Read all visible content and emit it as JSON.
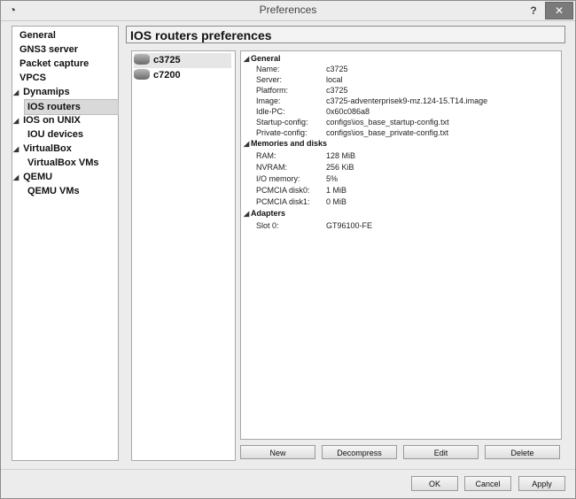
{
  "window": {
    "title": "Preferences",
    "help_label": "?",
    "close_label": "✕"
  },
  "nav": {
    "items": [
      {
        "label": "General",
        "indent": 0,
        "expand": ""
      },
      {
        "label": "GNS3 server",
        "indent": 0,
        "expand": ""
      },
      {
        "label": "Packet capture",
        "indent": 0,
        "expand": ""
      },
      {
        "label": "VPCS",
        "indent": 0,
        "expand": ""
      },
      {
        "label": "Dynamips",
        "indent": 0,
        "expand": "◢"
      },
      {
        "label": "IOS routers",
        "indent": 1,
        "expand": "",
        "selected": true
      },
      {
        "label": "IOS on UNIX",
        "indent": 0,
        "expand": "◢"
      },
      {
        "label": "IOU devices",
        "indent": 1,
        "expand": ""
      },
      {
        "label": "VirtualBox",
        "indent": 0,
        "expand": "◢"
      },
      {
        "label": "VirtualBox VMs",
        "indent": 1,
        "expand": ""
      },
      {
        "label": "QEMU",
        "indent": 0,
        "expand": "◢"
      },
      {
        "label": "QEMU VMs",
        "indent": 1,
        "expand": ""
      }
    ]
  },
  "page": {
    "title": "IOS routers preferences"
  },
  "routers": [
    {
      "name": "c3725",
      "selected": true
    },
    {
      "name": "c7200",
      "selected": false
    }
  ],
  "properties": {
    "general": {
      "label": "General",
      "rows": [
        {
          "name": "Name:",
          "value": "c3725"
        },
        {
          "name": "Server:",
          "value": "local"
        },
        {
          "name": "Platform:",
          "value": "c3725"
        },
        {
          "name": "Image:",
          "value": "c3725-adventerprisek9-mz.124-15.T14.image"
        },
        {
          "name": "Idle-PC:",
          "value": "0x60c086a8"
        },
        {
          "name": "Startup-config:",
          "value": "configs\\ios_base_startup-config.txt"
        },
        {
          "name": "Private-config:",
          "value": "configs\\ios_base_private-config.txt"
        }
      ]
    },
    "memory": {
      "label": "Memories and disks",
      "rows": [
        {
          "name": "RAM:",
          "value": "128 MiB"
        },
        {
          "name": "NVRAM:",
          "value": "256 KiB"
        },
        {
          "name": "I/O memory:",
          "value": "5%"
        },
        {
          "name": "PCMCIA disk0:",
          "value": "1 MiB"
        },
        {
          "name": "PCMCIA disk1:",
          "value": "0 MiB"
        }
      ]
    },
    "adapters": {
      "label": "Adapters",
      "rows": [
        {
          "name": "Slot 0:",
          "value": "GT96100-FE"
        }
      ]
    },
    "section_arrow": "◢"
  },
  "actions": {
    "new_label": "New",
    "decompress_label": "Decompress",
    "edit_label": "Edit",
    "delete_label": "Delete"
  },
  "dialog": {
    "ok_label": "OK",
    "cancel_label": "Cancel",
    "apply_label": "Apply"
  }
}
